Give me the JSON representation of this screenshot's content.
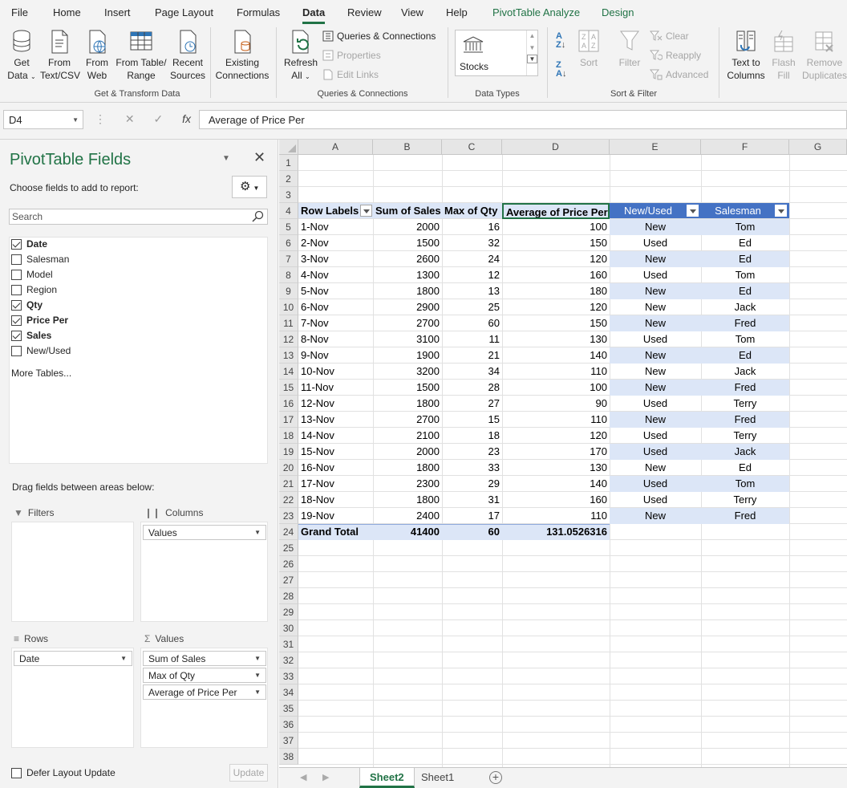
{
  "tabs": [
    {
      "label": "File"
    },
    {
      "label": "Home"
    },
    {
      "label": "Insert"
    },
    {
      "label": "Page Layout"
    },
    {
      "label": "Formulas"
    },
    {
      "label": "Data"
    },
    {
      "label": "Review"
    },
    {
      "label": "View"
    },
    {
      "label": "Help"
    },
    {
      "label": "PivotTable Analyze"
    },
    {
      "label": "Design"
    }
  ],
  "ribbon": {
    "get_data": {
      "line1": "Get",
      "line2": "Data"
    },
    "from_text": {
      "line1": "From",
      "line2": "Text/CSV"
    },
    "from_web": {
      "line1": "From",
      "line2": "Web"
    },
    "from_table": {
      "line1": "From Table/",
      "line2": "Range"
    },
    "recent_sources": {
      "line1": "Recent",
      "line2": "Sources"
    },
    "existing_connections": {
      "line1": "Existing",
      "line2": "Connections"
    },
    "group_get_transform": "Get & Transform Data",
    "refresh_all": {
      "line1": "Refresh",
      "line2": "All"
    },
    "queries_connections": "Queries & Connections",
    "properties": "Properties",
    "edit_links": "Edit Links",
    "group_queries": "Queries & Connections",
    "stocks": "Stocks",
    "group_data_types": "Data Types",
    "sort": "Sort",
    "filter": "Filter",
    "clear": "Clear",
    "reapply": "Reapply",
    "advanced": "Advanced",
    "group_sort_filter": "Sort & Filter",
    "text_to_columns": {
      "line1": "Text to",
      "line2": "Columns"
    },
    "flash_fill": {
      "line1": "Flash",
      "line2": "Fill"
    },
    "remove_duplicates": {
      "line1": "Remove",
      "line2": "Duplicates"
    }
  },
  "formula_bar": {
    "name_box": "D4",
    "formula": "Average of Price Per"
  },
  "pivot_panel": {
    "title": "PivotTable Fields",
    "choose_label": "Choose fields to add to report:",
    "search_placeholder": "Search",
    "fields": [
      {
        "label": "Date",
        "checked": true
      },
      {
        "label": "Salesman",
        "checked": false
      },
      {
        "label": "Model",
        "checked": false
      },
      {
        "label": "Region",
        "checked": false
      },
      {
        "label": "Qty",
        "checked": true
      },
      {
        "label": "Price Per",
        "checked": true
      },
      {
        "label": "Sales",
        "checked": true
      },
      {
        "label": "New/Used",
        "checked": false
      }
    ],
    "more_tables": "More Tables...",
    "drag_label": "Drag fields between areas below:",
    "filters_label": "Filters",
    "columns_label": "Columns",
    "rows_label": "Rows",
    "values_label": "Values",
    "columns_items": [
      "Values"
    ],
    "rows_items": [
      "Date"
    ],
    "values_items": [
      "Sum of Sales",
      "Max of Qty",
      "Average of Price Per"
    ],
    "defer_label": "Defer Layout Update",
    "update_label": "Update"
  },
  "sheet": {
    "columns": [
      "A",
      "B",
      "C",
      "D",
      "E",
      "F",
      "G"
    ],
    "row_numbers": [
      "1",
      "2",
      "3",
      "4",
      "5",
      "6",
      "7",
      "8",
      "9",
      "10",
      "11",
      "12",
      "13",
      "14",
      "15",
      "16",
      "17",
      "18",
      "19",
      "20",
      "21",
      "22",
      "23",
      "24",
      "25",
      "26",
      "27",
      "28",
      "29",
      "30",
      "31",
      "32",
      "33",
      "34",
      "35",
      "36",
      "37",
      "38"
    ],
    "pivot_headers": [
      "Row Labels",
      "Sum of Sales",
      "Max of Qty",
      "Average of Price Per"
    ],
    "extra_headers": [
      "New/Used",
      "Salesman"
    ],
    "rows": [
      {
        "date": "1-Nov",
        "sales": "2000",
        "qty": "16",
        "price": "100",
        "nu": "New",
        "salesman": "Tom"
      },
      {
        "date": "2-Nov",
        "sales": "1500",
        "qty": "32",
        "price": "150",
        "nu": "Used",
        "salesman": "Ed"
      },
      {
        "date": "3-Nov",
        "sales": "2600",
        "qty": "24",
        "price": "120",
        "nu": "New",
        "salesman": "Ed"
      },
      {
        "date": "4-Nov",
        "sales": "1300",
        "qty": "12",
        "price": "160",
        "nu": "Used",
        "salesman": "Tom"
      },
      {
        "date": "5-Nov",
        "sales": "1800",
        "qty": "13",
        "price": "180",
        "nu": "New",
        "salesman": "Ed"
      },
      {
        "date": "6-Nov",
        "sales": "2900",
        "qty": "25",
        "price": "120",
        "nu": "New",
        "salesman": "Jack"
      },
      {
        "date": "7-Nov",
        "sales": "2700",
        "qty": "60",
        "price": "150",
        "nu": "New",
        "salesman": "Fred"
      },
      {
        "date": "8-Nov",
        "sales": "3100",
        "qty": "11",
        "price": "130",
        "nu": "Used",
        "salesman": "Tom"
      },
      {
        "date": "9-Nov",
        "sales": "1900",
        "qty": "21",
        "price": "140",
        "nu": "New",
        "salesman": "Ed"
      },
      {
        "date": "10-Nov",
        "sales": "3200",
        "qty": "34",
        "price": "110",
        "nu": "New",
        "salesman": "Jack"
      },
      {
        "date": "11-Nov",
        "sales": "1500",
        "qty": "28",
        "price": "100",
        "nu": "New",
        "salesman": "Fred"
      },
      {
        "date": "12-Nov",
        "sales": "1800",
        "qty": "27",
        "price": "90",
        "nu": "Used",
        "salesman": "Terry"
      },
      {
        "date": "13-Nov",
        "sales": "2700",
        "qty": "15",
        "price": "110",
        "nu": "New",
        "salesman": "Fred"
      },
      {
        "date": "14-Nov",
        "sales": "2100",
        "qty": "18",
        "price": "120",
        "nu": "Used",
        "salesman": "Terry"
      },
      {
        "date": "15-Nov",
        "sales": "2000",
        "qty": "23",
        "price": "170",
        "nu": "Used",
        "salesman": "Jack"
      },
      {
        "date": "16-Nov",
        "sales": "1800",
        "qty": "33",
        "price": "130",
        "nu": "New",
        "salesman": "Ed"
      },
      {
        "date": "17-Nov",
        "sales": "2300",
        "qty": "29",
        "price": "140",
        "nu": "Used",
        "salesman": "Tom"
      },
      {
        "date": "18-Nov",
        "sales": "1800",
        "qty": "31",
        "price": "160",
        "nu": "Used",
        "salesman": "Terry"
      },
      {
        "date": "19-Nov",
        "sales": "2400",
        "qty": "17",
        "price": "110",
        "nu": "New",
        "salesman": "Fred"
      }
    ],
    "grand_total": {
      "label": "Grand Total",
      "sales": "41400",
      "qty": "60",
      "price": "131.0526316"
    }
  },
  "sheet_tabs": [
    {
      "label": "Sheet2",
      "active": true
    },
    {
      "label": "Sheet1",
      "active": false
    }
  ],
  "colors": {
    "accent": "#217346",
    "pivot_header": "#dce6f7",
    "table_header": "#4472c4",
    "band": "#dce6f7"
  }
}
